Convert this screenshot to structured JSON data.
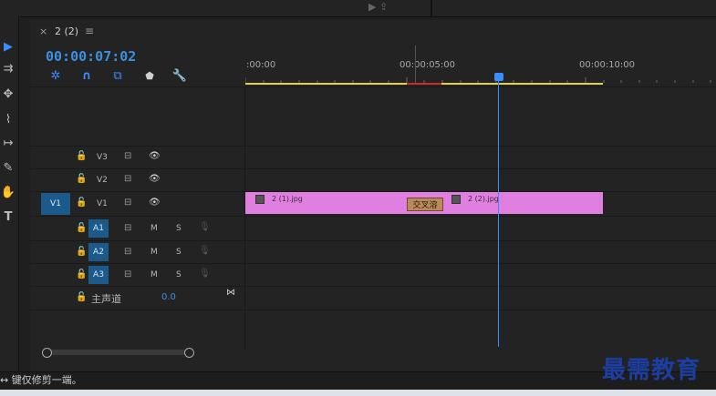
{
  "tab": {
    "close": "×",
    "name": "2 (2)",
    "menu": "≡"
  },
  "timecode": "00:00:07:02",
  "ruler": {
    "labels": [
      ":00:00",
      "00:00:05:00",
      "00:00:10:00"
    ]
  },
  "tracks": {
    "video": [
      {
        "name": "V3",
        "source": ""
      },
      {
        "name": "V2",
        "source": ""
      },
      {
        "name": "V1",
        "source": "V1"
      }
    ],
    "audio": [
      {
        "name": "A1",
        "m": "M",
        "s": "S"
      },
      {
        "name": "A2",
        "m": "M",
        "s": "S"
      },
      {
        "name": "A3",
        "m": "M",
        "s": "S"
      }
    ],
    "master": {
      "name": "主声道",
      "value": "0.0"
    }
  },
  "clips": {
    "clip1": "2 (1).jpg",
    "clip2": "2 (2).jpg",
    "transition": "交叉溶"
  },
  "status": "↔ 键仅修剪一端。",
  "watermark": "最需教育",
  "colors": {
    "accent": "#3b8cff",
    "clip": "#e07fe0",
    "yellow": "#e3d23a"
  }
}
